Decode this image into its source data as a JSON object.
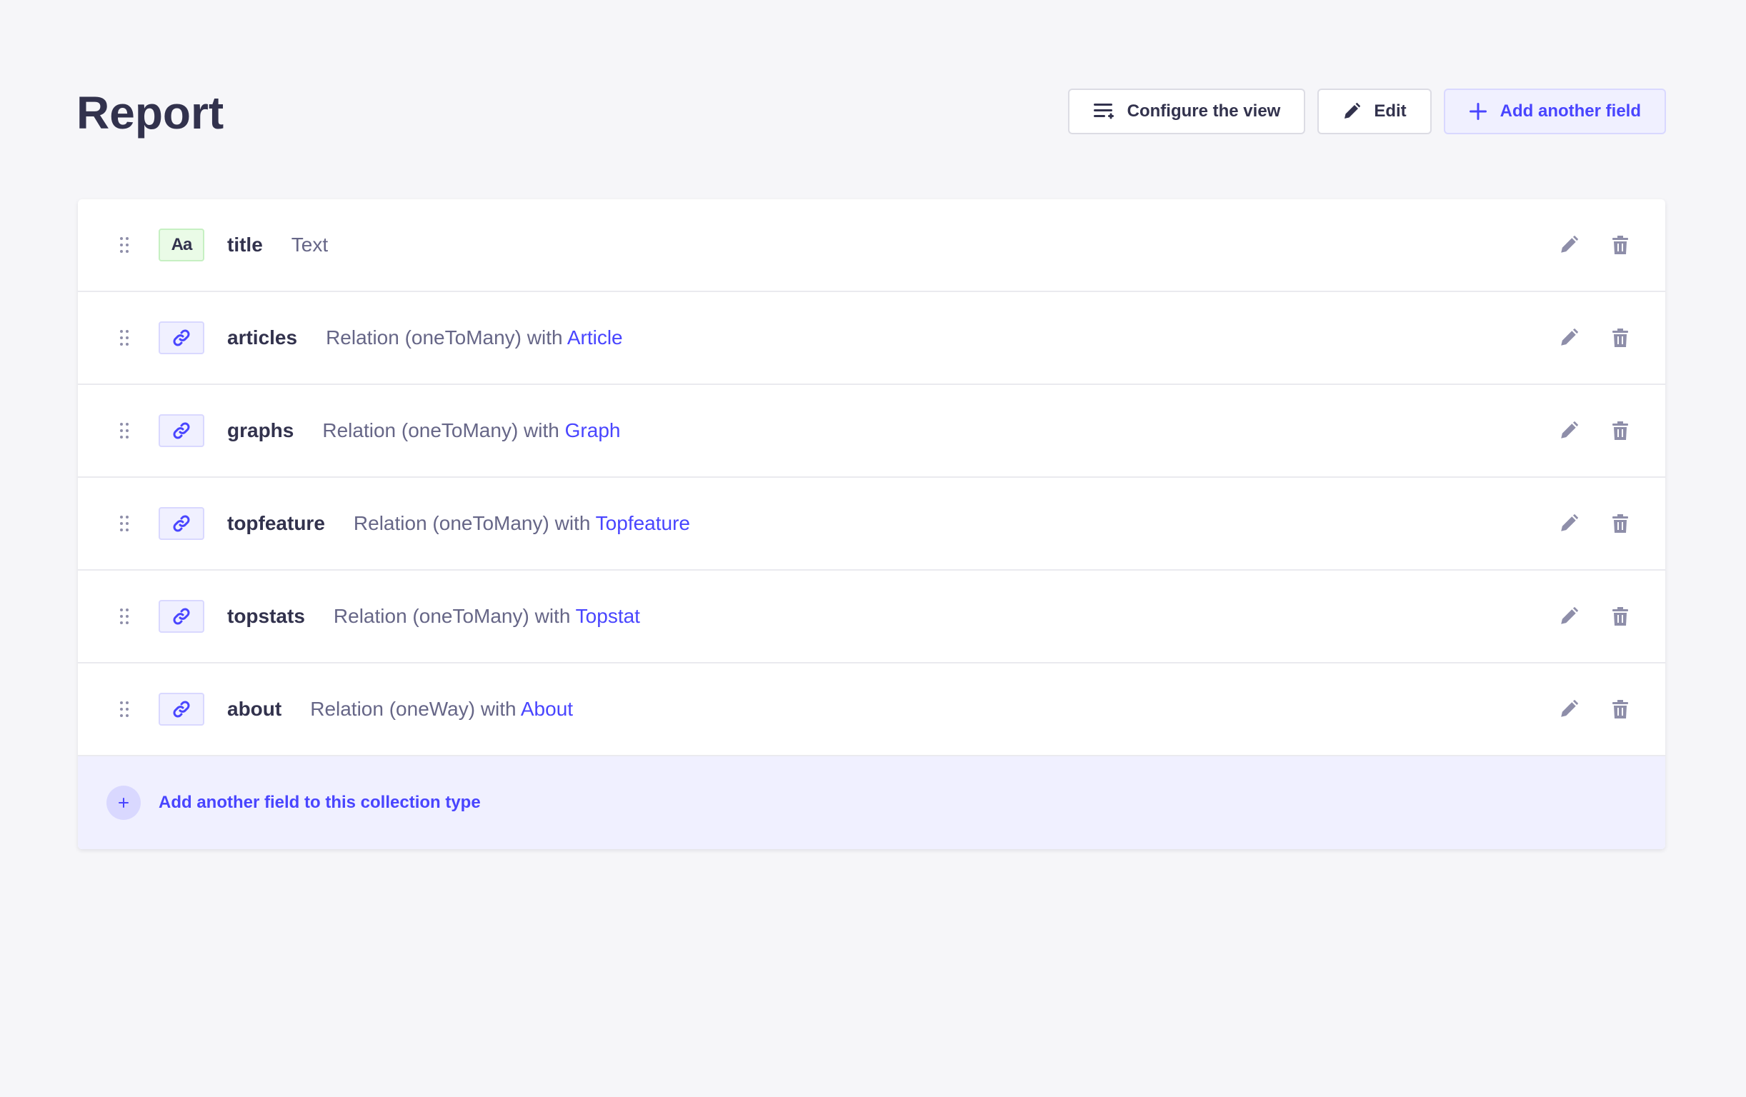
{
  "page": {
    "title": "Report"
  },
  "header_actions": {
    "configure_label": "Configure the view",
    "edit_label": "Edit",
    "add_field_label": "Add another field"
  },
  "fields": [
    {
      "name": "title",
      "type_badge": "Aa",
      "badge_kind": "text",
      "description": "Text",
      "target": ""
    },
    {
      "name": "articles",
      "type_badge": "relation-icon",
      "badge_kind": "relation",
      "description": "Relation (oneToMany) with ",
      "target": "Article"
    },
    {
      "name": "graphs",
      "type_badge": "relation-icon",
      "badge_kind": "relation",
      "description": "Relation (oneToMany) with ",
      "target": "Graph"
    },
    {
      "name": "topfeature",
      "type_badge": "relation-icon",
      "badge_kind": "relation",
      "description": "Relation (oneToMany) with ",
      "target": "Topfeature"
    },
    {
      "name": "topstats",
      "type_badge": "relation-icon",
      "badge_kind": "relation",
      "description": "Relation (oneToMany) with ",
      "target": "Topstat"
    },
    {
      "name": "about",
      "type_badge": "relation-icon",
      "badge_kind": "relation",
      "description": "Relation (oneWay) with ",
      "target": "About"
    }
  ],
  "footer": {
    "add_field_label": "Add another field to this collection type"
  },
  "colors": {
    "primary": "#4945ff",
    "text": "#32324d",
    "muted": "#666687",
    "icon": "#8e8ea9"
  }
}
